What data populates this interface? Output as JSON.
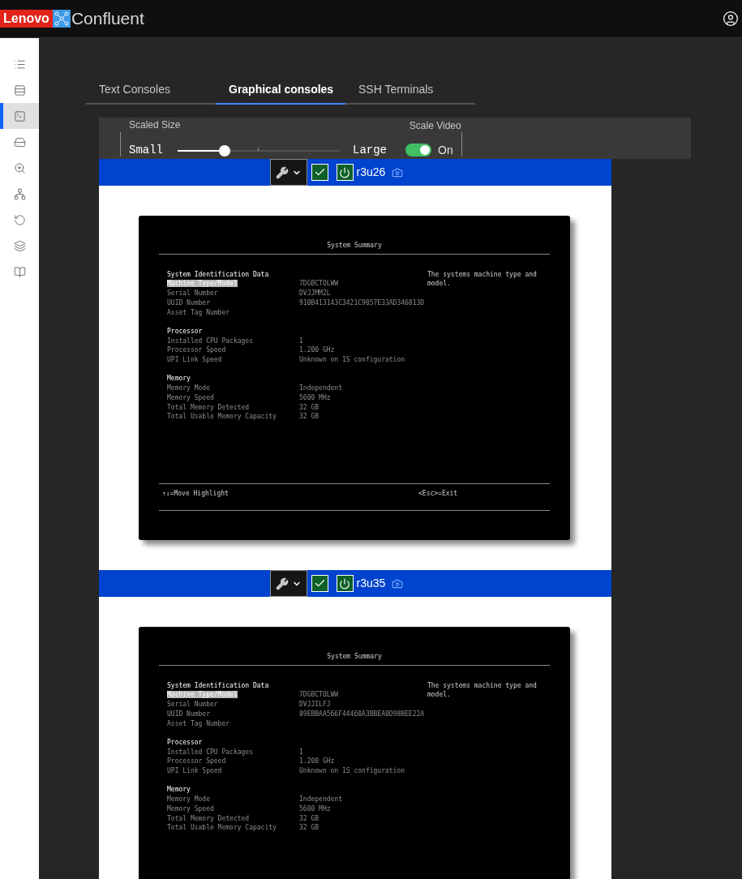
{
  "header": {
    "brand": "Lenovo",
    "product": "Confluent"
  },
  "sidebar": [
    {
      "kind": "list",
      "selected": false
    },
    {
      "kind": "rack",
      "selected": false
    },
    {
      "kind": "console",
      "selected": true
    },
    {
      "kind": "disk",
      "selected": false
    },
    {
      "kind": "inspect",
      "selected": false
    },
    {
      "kind": "network",
      "selected": false
    },
    {
      "kind": "restore",
      "selected": false
    },
    {
      "kind": "layers",
      "selected": false
    },
    {
      "kind": "book",
      "selected": false
    }
  ],
  "tabs": [
    {
      "label": "Text Consoles",
      "selected": false
    },
    {
      "label": "Graphical consoles",
      "selected": true
    },
    {
      "label": "SSH Terminals",
      "selected": false
    }
  ],
  "controls": {
    "scaled_size": {
      "label": "Scaled Size",
      "min_label": "Small",
      "max_label": "Large",
      "level": 0.29
    },
    "scale_video": {
      "label": "Scale Video",
      "on": true,
      "state_label": "On"
    }
  },
  "consoles": [
    {
      "name": "r3u26",
      "checked": true,
      "screen": {
        "title": "System Summary",
        "help": "The systems machine type and model.",
        "sections": [
          {
            "heading": "System Identification Data",
            "rows": [
              {
                "label": "Machine Type/Model",
                "value": "7DGBCTOLWW",
                "selected": true
              },
              {
                "label": "Serial Number",
                "value": "DVJJMM2L",
                "selected": false
              },
              {
                "label": "UUID Number",
                "value": "910B413143C3421C9057E33AD346813D",
                "selected": false
              },
              {
                "label": "Asset Tag Number",
                "selected": false
              }
            ]
          },
          {
            "heading": "Processor",
            "rows": [
              {
                "label": "Installed CPU Packages",
                "value": "1",
                "selected": false
              },
              {
                "label": "Processor Speed",
                "value": "1.200 GHz",
                "selected": false
              },
              {
                "label": "UPI Link Speed",
                "value": "Unknown on 1S configuration",
                "selected": false
              }
            ]
          },
          {
            "heading": "Memory",
            "rows": [
              {
                "label": "Memory Mode",
                "value": "Independent",
                "selected": false
              },
              {
                "label": "Memory Speed",
                "value": "5600 MHz",
                "selected": false
              },
              {
                "label": "Total Memory Detected",
                "value": "32 GB",
                "selected": false
              },
              {
                "label": "Total Usable Memory Capacity",
                "value": "32 GB",
                "selected": false
              }
            ]
          }
        ],
        "footer_left": "↑↓=Move Highlight",
        "footer_right": "<Esc>=Exit"
      }
    },
    {
      "name": "r3u35",
      "checked": true,
      "screen": {
        "title": "System Summary",
        "help": "The systems machine type and model.",
        "sections": [
          {
            "heading": "System Identification Data",
            "rows": [
              {
                "label": "Machine Type/Model",
                "value": "7DGBCTOLWW",
                "selected": true
              },
              {
                "label": "Serial Number",
                "value": "DVJJILFJ",
                "selected": false
              },
              {
                "label": "UUID Number",
                "value": "89EBBAA566F44460A3BBEA0D98BEE22A",
                "selected": false
              },
              {
                "label": "Asset Tag Number",
                "selected": false
              }
            ]
          },
          {
            "heading": "Processor",
            "rows": [
              {
                "label": "Installed CPU Packages",
                "value": "1",
                "selected": false
              },
              {
                "label": "Processor Speed",
                "value": "1.200 GHz",
                "selected": false
              },
              {
                "label": "UPI Link Speed",
                "value": "Unknown on 1S configuration",
                "selected": false
              }
            ]
          },
          {
            "heading": "Memory",
            "rows": [
              {
                "label": "Memory Mode",
                "value": "Independent",
                "selected": false
              },
              {
                "label": "Memory Speed",
                "value": "5600 MHz",
                "selected": false
              },
              {
                "label": "Total Memory Detected",
                "value": "32 GB",
                "selected": false
              },
              {
                "label": "Total Usable Memory Capacity",
                "value": "32 GB",
                "selected": false
              }
            ]
          }
        ]
      }
    }
  ]
}
